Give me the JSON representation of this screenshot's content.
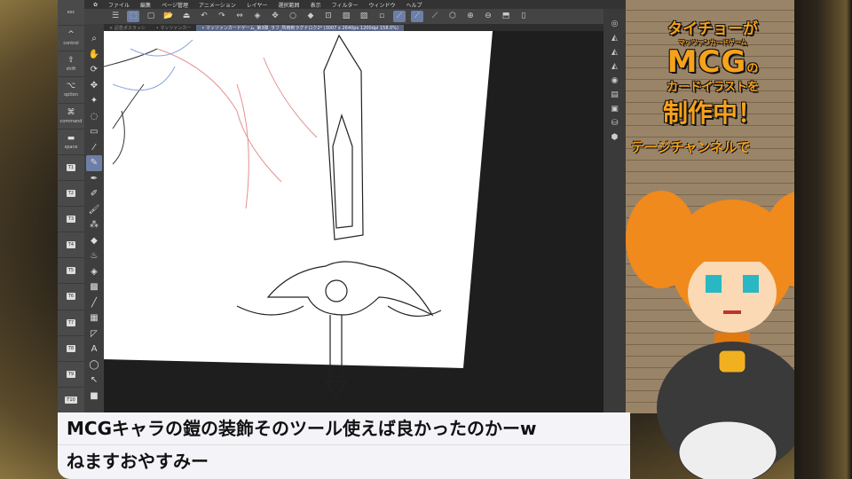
{
  "app": {
    "menu": [
      "ファイル",
      "編集",
      "ページ管理",
      "アニメーション",
      "レイヤー",
      "選択範囲",
      "表示",
      "フィルター",
      "ウィンドウ",
      "ヘルプ"
    ],
    "tabs": [
      {
        "label": "× 記念ポスラッシ"
      },
      {
        "label": "• マッツァンカー"
      },
      {
        "label": "• マッツァンカードゲーム_第3弾_ラフ_所用刺ラグナロク2* (3007 x 2640px 1200dpi 158.0%)",
        "active": true
      }
    ],
    "modifier_keys": [
      {
        "glyph": "esc",
        "label": "esc"
      },
      {
        "glyph": "^",
        "label": "control"
      },
      {
        "glyph": "⇧",
        "label": "shift"
      },
      {
        "glyph": "⌥",
        "label": "option"
      },
      {
        "glyph": "⌘",
        "label": "command"
      },
      {
        "glyph": "▬",
        "label": "space"
      },
      {
        "label": "T1"
      },
      {
        "label": "T2"
      },
      {
        "label": "T3"
      },
      {
        "label": "T4"
      },
      {
        "label": "T5"
      },
      {
        "label": "T6"
      },
      {
        "label": "T7"
      },
      {
        "label": "T8"
      },
      {
        "label": "T9"
      },
      {
        "label": "T10"
      }
    ],
    "tools": [
      "zoom",
      "hand",
      "rotate",
      "move",
      "auto-select",
      "lasso",
      "rect-select",
      "eyedropper",
      "pen",
      "marker",
      "pencil",
      "brush",
      "decoration",
      "eraser",
      "blend",
      "fill",
      "gradient",
      "line",
      "frame",
      "ruler",
      "text",
      "balloon",
      "operation",
      "color"
    ],
    "active_tool": "pen"
  },
  "overlay": {
    "line1": "タイチョーが",
    "ruby": "マッツァンカードゲーム",
    "line2": "MCG",
    "line2_suffix": "の",
    "line3": "カードイラストを",
    "line4": "制作中！",
    "subtitle": "テージチャンネルで",
    "accent": "#f7a21b"
  },
  "chat": {
    "messages": [
      "MCGキャラの鎧の装飾そのツール使えば良かったのかーw",
      "ねますおやすみー"
    ]
  }
}
